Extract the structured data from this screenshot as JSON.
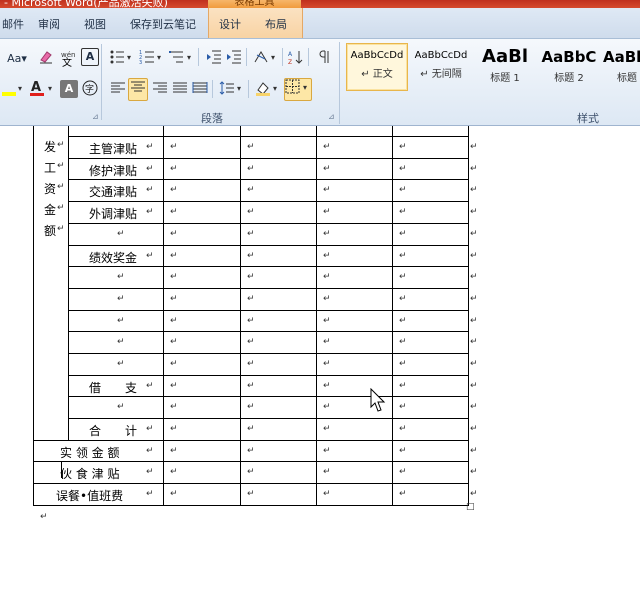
{
  "window": {
    "title": "- Microsoft Word(产品激活失败)"
  },
  "context_tab_group": "表格工具",
  "tabs": [
    "邮件",
    "审阅",
    "视图",
    "保存到云笔记",
    "设计",
    "布局"
  ],
  "ribbon": {
    "font_group": {
      "aa_label": "Aa▾",
      "phonetic": "wén",
      "border_char": "A"
    },
    "paragraph_label": "段落",
    "styles_label": "样式",
    "styles": [
      {
        "sample": "AaBbCcDd",
        "name": "↵ 正文",
        "selected": true
      },
      {
        "sample": "AaBbCcDd",
        "name": "↵ 无间隔",
        "selected": false
      },
      {
        "sample": "AaBl",
        "name": "标题 1",
        "selected": false
      },
      {
        "sample": "AaBbC",
        "name": "标题 2",
        "selected": false
      },
      {
        "sample": "AaBl",
        "name": "标题",
        "selected": false
      }
    ]
  },
  "table": {
    "left_column_chars": [
      "发",
      "工",
      "资",
      "金",
      "额"
    ],
    "rows": [
      "主管津贴",
      "修护津贴",
      "交通津贴",
      "外调津贴",
      "",
      "绩效奖金",
      "",
      "",
      "",
      "",
      "",
      "借　　支",
      "",
      "合　　计",
      "实 领 金 额",
      "伙 食 津 贴",
      "误餐•值班费"
    ]
  },
  "colors": {
    "accent_title": "#c0301e",
    "context_tab": "#f19b3d"
  }
}
